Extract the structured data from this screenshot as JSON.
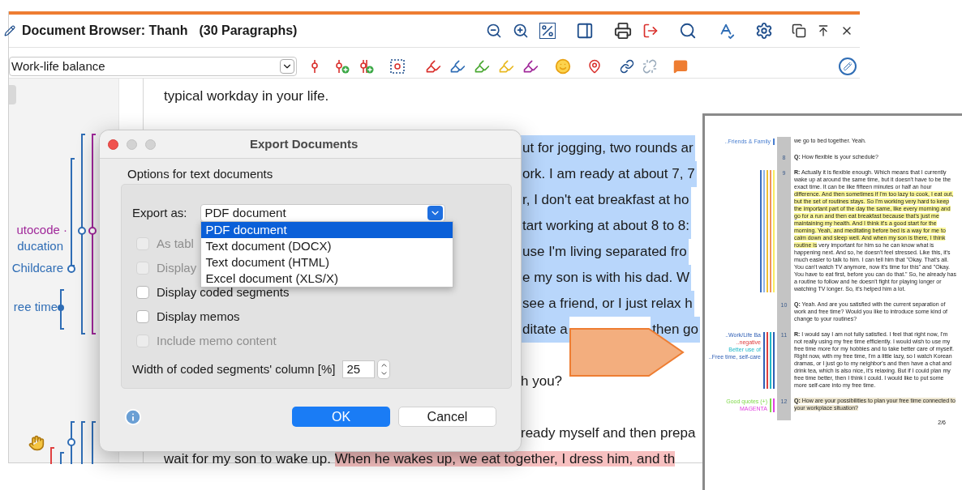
{
  "window": {
    "title": "Document Browser: Thanh",
    "subtitle": "(30 Paragraphs)"
  },
  "code_selector": {
    "value": "Work-life balance"
  },
  "margin_codes": [
    {
      "label": "utocode ·",
      "color": "#a0289a"
    },
    {
      "label": "ducation",
      "color": "#2f6db5"
    },
    {
      "label": "Childcare",
      "color": "#2f6db5"
    },
    {
      "label": "ree time",
      "color": "#2f6db5"
    }
  ],
  "document_paragraphs": [
    {
      "lines": [
        {
          "kind": "full",
          "segments": [
            {
              "text": "typical workday in your life."
            }
          ]
        }
      ]
    },
    {
      "lines": [
        {
          "kind": "fragment",
          "segments": [
            {
              "text": "ut for jogging, two rounds ar",
              "color": "#b8d6fb"
            }
          ]
        },
        {
          "kind": "fragment",
          "segments": [
            {
              "text": "ork. I am ready at about 7, 7",
              "color": "#b8d6fb"
            }
          ]
        },
        {
          "kind": "fragment",
          "segments": [
            {
              "text": "r, I don't eat breakfast at ho",
              "color": "#b8d6fb"
            }
          ]
        },
        {
          "kind": "fragment",
          "segments": [
            {
              "text": "tart working at about 8 to 8:",
              "color": "#b8d6fb"
            }
          ]
        },
        {
          "kind": "fragment",
          "segments": [
            {
              "text": "use I'm living separated fro",
              "color": "#b8d6fb"
            }
          ]
        },
        {
          "kind": "fragment",
          "segments": [
            {
              "text": "e my son is with his dad. W",
              "color": "#b8d6fb"
            }
          ]
        },
        {
          "kind": "fragment",
          "segments": [
            {
              "text": "see a friend, or I just relax h",
              "color": "#b8d6fb"
            }
          ]
        },
        {
          "kind": "fragment",
          "segments": [
            {
              "text": "ditate a",
              "color": "#b8d6fb"
            },
            {
              "text": "then go",
              "color": "#b8d6fb"
            }
          ]
        }
      ]
    },
    {
      "lines": [
        {
          "kind": "fragment",
          "segments": [
            {
              "text": "h you?"
            }
          ]
        }
      ]
    },
    {
      "lines": [
        {
          "kind": "fragment",
          "segments": [
            {
              "text": "ready myself and then prepa"
            }
          ]
        },
        {
          "kind": "full",
          "segments": [
            {
              "text": "wait for my son to wake up. "
            },
            {
              "text": "When he wakes up, we eat together, I dress him, and th",
              "color": "#f7c0c0"
            }
          ]
        }
      ]
    }
  ],
  "dialog": {
    "title": "Export Documents",
    "group_label": "Options for text documents",
    "export_label": "Export as:",
    "export_value": "PDF document",
    "export_options": [
      {
        "label": "PDF document",
        "selected": true
      },
      {
        "label": "Text document (DOCX)",
        "selected": false
      },
      {
        "label": "Text document (HTML)",
        "selected": false
      },
      {
        "label": "Excel document (XLS/X)",
        "selected": false
      }
    ],
    "options": [
      {
        "label": "As tabl",
        "checked": false,
        "disabled": true
      },
      {
        "label": "Display",
        "checked": false,
        "disabled": true
      },
      {
        "label": "Display coded segments",
        "checked": false,
        "disabled": false
      },
      {
        "label": "Display memos",
        "checked": false,
        "disabled": false
      },
      {
        "label": "Include memo content",
        "checked": false,
        "disabled": true
      }
    ],
    "width_label": "Width of coded segments' column [%]",
    "width_value": "25",
    "ok": "OK",
    "cancel": "Cancel"
  },
  "pdf_page": {
    "paragraphs": [
      {
        "codes": [
          {
            "label": "..Friends & Family",
            "color": "#4a7fd0"
          }
        ],
        "segments": [
          {
            "text": "we go to bed together. Yeah."
          }
        ]
      },
      {
        "number": "8",
        "segments": [
          {
            "text": "**Q:** How flexible is your schedule?"
          }
        ]
      },
      {
        "number": "9",
        "codes": [
          {
            "color": "#3b6fc0"
          },
          {
            "color": "#8fb4e8"
          },
          {
            "color": "#f0c030"
          },
          {
            "color": "#f0945a"
          },
          {
            "color": "#f7ee60"
          }
        ],
        "segments": [
          {
            "text": "**R:** Actually it is flexible enough. Which means that I currently wake up at around the same time, but it doesn't have to be the exact time. It can be like fifteen minutes or half an hour "
          },
          {
            "text": "difference. And then sometimes if I'm too lazy to cook, I eat out, but the set of routines stays. So I'm working very hard to keep the important part of the day the same, like every morning and go for a run and then eat breakfast because that's just me maintaining my health. And I think it's a good start for the morning. Yeah, and meditating before bed is a way for me to calm down and sleep well. And when my son is there, I think routine is",
            "color": "#fdf99a"
          },
          {
            "text": " very important for him so he can know what is happening next. And so, he doesn't feel stressed. Like this, it's much easier to talk to him. I can tell him that \"Okay. That's all. You can't watch TV anymore, now it's time for this\" and \"Okay. You have to eat first, before you can do that.\" So, he already has a routine to follow and he doesn't fight for playing longer or watching TV longer. So, it's helped him a lot."
          }
        ]
      },
      {
        "number": "10",
        "segments": [
          {
            "text": "**Q:** Yeah. And are you satisfied with the current separation of work and free time? Would you like to introduce some kind of change to your routines?"
          }
        ]
      },
      {
        "number": "11",
        "codes": [
          {
            "label": "..Work/Life Ba",
            "color": "#2f5fb5"
          },
          {
            "label": "..negative",
            "color": "#e04040"
          },
          {
            "label": "Better use of",
            "color": "#20b8c8"
          },
          {
            "label": "..Free time, self-care",
            "color": "#2f5fb5"
          }
        ],
        "segments": [
          {
            "text": "**R:** I would say I am not fully satisfied. I feel that right now, I'm not really using my free time efficiently. I would wish to use my free time more for my hobbies and to take better care of myself. Right now, with my free time, I'm a little lazy, so I watch Korean dramas, or I just go to my neighbor's and then have a chat and drink tea, which is also nice, it's relaxing. But if I could plan my free time better, then I think I could. I would like to put some more self-care into my free time."
          }
        ]
      },
      {
        "number": "12",
        "codes": [
          {
            "label": "Good quotes (+)",
            "color": "#7ed848"
          },
          {
            "label": "MAGENTA",
            "color": "#e040e0"
          }
        ],
        "segments": [
          {
            "text": "**Q:** How are your possibilities to plan your free time connected to your workplace situation?",
            "color": "#efe8d2"
          }
        ]
      }
    ],
    "page_number": "2/6"
  }
}
